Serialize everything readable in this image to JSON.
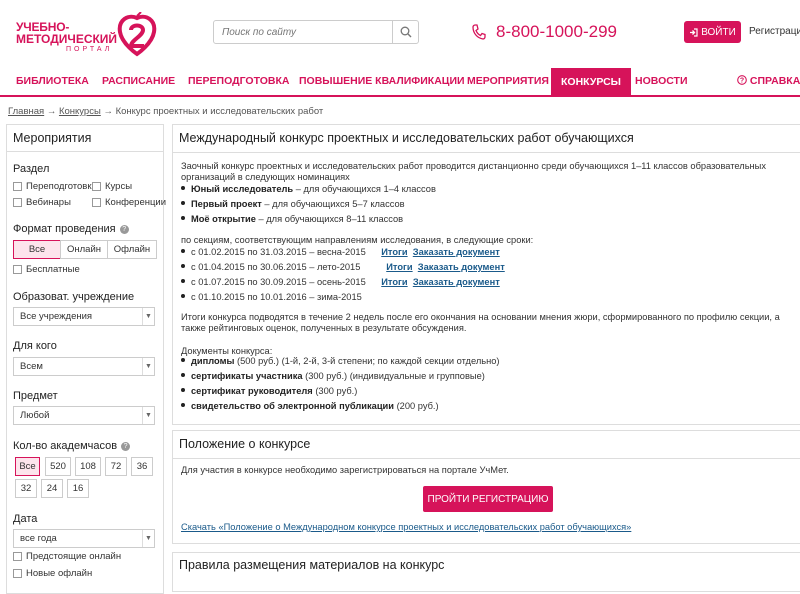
{
  "header": {
    "logo_line1": "УЧЕБНО-",
    "logo_line2": "МЕТОДИЧЕСКИЙ",
    "logo_line3": "ПОРТАЛ",
    "search_placeholder": "Поиск по сайту",
    "phone": "8-800-1000-299",
    "login_label": "ВОЙТИ",
    "register_label": "Регистрация"
  },
  "nav": {
    "items": [
      "БИБЛИОТЕКА",
      "РАСПИСАНИЕ",
      "ПЕРЕПОДГОТОВКА",
      "ПОВЫШЕНИЕ КВАЛИФИКАЦИИ",
      "МЕРОПРИЯТИЯ",
      "КОНКУРСЫ",
      "НОВОСТИ"
    ],
    "help": "СПРАВКА",
    "active": "КОНКУРСЫ"
  },
  "breadcrumb": {
    "home": "Главная",
    "section": "Конкурсы",
    "current": "Конкурс проектных и исследовательских работ"
  },
  "sidebar": {
    "title": "Мероприятия",
    "section_label": "Раздел",
    "section_options": [
      "Переподготовка",
      "Курсы",
      "Вебинары",
      "Конференции"
    ],
    "format_label": "Формат проведения",
    "format_options": [
      "Все",
      "Онлайн",
      "Офлайн"
    ],
    "free_label": "Бесплатные",
    "institution_label": "Образоват. учреждение",
    "institution_value": "Все учреждения",
    "for_whom_label": "Для кого",
    "for_whom_value": "Всем",
    "subject_label": "Предмет",
    "subject_value": "Любой",
    "hours_label": "Кол-во академчасов",
    "hours_options": [
      "Все",
      "520",
      "108",
      "72",
      "36",
      "32",
      "24",
      "16"
    ],
    "date_label": "Дата",
    "date_value": "все года",
    "upcoming_online": "Предстоящие онлайн",
    "new_offline": "Новые офлайн"
  },
  "main": {
    "title": "Международный конкурс проектных и исследовательских работ обучающихся",
    "intro": "Заочный конкурс проектных и исследовательских работ проводится дистанционно среди обучающихся 1–11 классов образовательных организаций в следующих номинациях",
    "nominations": [
      {
        "name": "Юный исследователь",
        "desc": " – для обучающихся 1–4 классов"
      },
      {
        "name": "Первый проект",
        "desc": " – для обучающихся 5–7 классов"
      },
      {
        "name": "Моё открытие",
        "desc": " – для обучающихся 8–11 классов"
      }
    ],
    "sections_text": "по секциям, соответствующим направлениям исследования, в следующие сроки:",
    "periods": [
      {
        "text": "с 01.02.2015 по 31.03.2015 – весна-2015",
        "results": "Итоги",
        "order": "Заказать документ"
      },
      {
        "text": "с 01.04.2015 по 30.06.2015 – лето-2015",
        "results": "Итоги",
        "order": "Заказать документ"
      },
      {
        "text": "с 01.07.2015 по 30.09.2015 – осень-2015",
        "results": "Итоги",
        "order": "Заказать документ"
      },
      {
        "text": "с 01.10.2015 по 10.01.2016 – зима-2015",
        "results": "",
        "order": ""
      }
    ],
    "results_text": "Итоги конкурса подводятся в течение 2 недель после его окончания на основании мнения жюри, сформированного по профилю секции, а также рейтинговых оценок, полученных в результате обсуждения.",
    "documents_label": "Документы конкурса:",
    "documents": [
      {
        "name": "дипломы",
        "desc": " (500 руб.) (1-й, 2-й, 3-й степени; по каждой секции отдельно)"
      },
      {
        "name": "сертификаты участника",
        "desc": " (300 руб.) (индивидуальные и групповые)"
      },
      {
        "name": "сертификат руководителя",
        "desc": " (300 руб.)"
      },
      {
        "name": "свидетельство об электронной публикации",
        "desc": " (200 руб.)"
      }
    ]
  },
  "regulation": {
    "title": "Положение о конкурсе",
    "text": "Для участия в конкурсе необходимо зарегистрироваться на портале УчМет.",
    "button": "ПРОЙТИ РЕГИСТРАЦИЮ",
    "download": "Скачать «Положение о Международном конкурсе проектных и исследовательских работ обучающихся»"
  },
  "rules": {
    "title": "Правила размещения материалов на конкурс"
  },
  "colors": {
    "accent": "#d6135a",
    "link": "#1a5a8a"
  }
}
